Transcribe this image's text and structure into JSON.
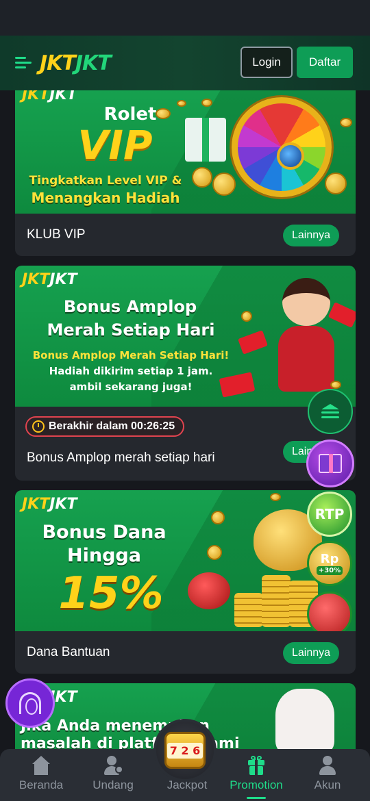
{
  "header": {
    "logo_part1": "JKT",
    "logo_part2": "JKT",
    "login_label": "Login",
    "register_label": "Daftar"
  },
  "promotions": [
    {
      "banner_title_line1": "Rolet",
      "banner_title_line2": "VIP",
      "banner_sub_line1": "Tingkatkan Level VIP &",
      "banner_sub_line2": "Menangkan Hadiah",
      "title": "KLUB VIP",
      "more_label": "Lainnya"
    },
    {
      "banner_title_line1": "Bonus Amplop",
      "banner_title_line2": "Merah Setiap Hari",
      "banner_sub_line1": "Bonus Amplop Merah Setiap Hari!",
      "banner_sub_line2": "Hadiah dikirim setiap 1 jam.",
      "banner_sub_line3": "ambil sekarang juga!",
      "timer_label": "Berakhir dalam 00:26:25",
      "title": "Bonus Amplop merah setiap hari",
      "more_label": "Lainnya"
    },
    {
      "banner_title_line1": "Bonus Dana",
      "banner_title_line2": "Hingga",
      "banner_percent": "15%",
      "badge_rtp": "RTP",
      "badge_rp": "Rp",
      "badge_rp_sub": "+30%",
      "title": "Dana Bantuan",
      "more_label": "Lainnya"
    },
    {
      "banner_text_line1": "Jika Anda menemukan",
      "banner_text_line2": "masalah di platform Kami"
    }
  ],
  "jackpot_reels": "7 2 6",
  "bottom_nav": [
    {
      "label": "Beranda",
      "icon": "home-icon",
      "active": false
    },
    {
      "label": "Undang",
      "icon": "invite-icon",
      "active": false
    },
    {
      "label": "Jackpot",
      "icon": "slot-machine-icon",
      "active": false
    },
    {
      "label": "Promotion",
      "icon": "gift-icon",
      "active": true
    },
    {
      "label": "Akun",
      "icon": "user-icon",
      "active": false
    }
  ],
  "colors": {
    "background": "#16181d",
    "accent_green": "#0e9d56",
    "logo_yellow": "#ffd21a",
    "active_nav": "#1fdc8a",
    "timer_border": "#e0434f"
  }
}
